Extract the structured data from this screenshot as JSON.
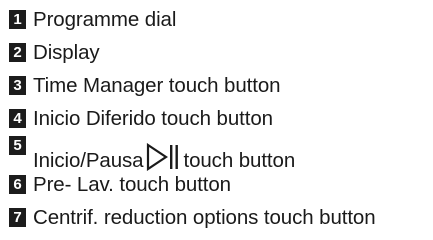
{
  "items": [
    {
      "number": "1",
      "label": "Programme dial"
    },
    {
      "number": "2",
      "label": "Display"
    },
    {
      "number": "3",
      "label": "Time Manager touch button"
    },
    {
      "number": "4",
      "label": "Inicio Diferido touch button"
    },
    {
      "number": "5",
      "label_before": "Inicio/Pausa",
      "icon": "play-pause-icon",
      "label_after": "touch button"
    },
    {
      "number": "6",
      "label": "Pre- Lav. touch button"
    },
    {
      "number": "7",
      "label": "Centrif. reduction options touch button"
    }
  ],
  "colors": {
    "badge_background": "#1c1c1c",
    "badge_text": "#ffffff",
    "text": "#1a1a1a",
    "background": "#ffffff"
  }
}
